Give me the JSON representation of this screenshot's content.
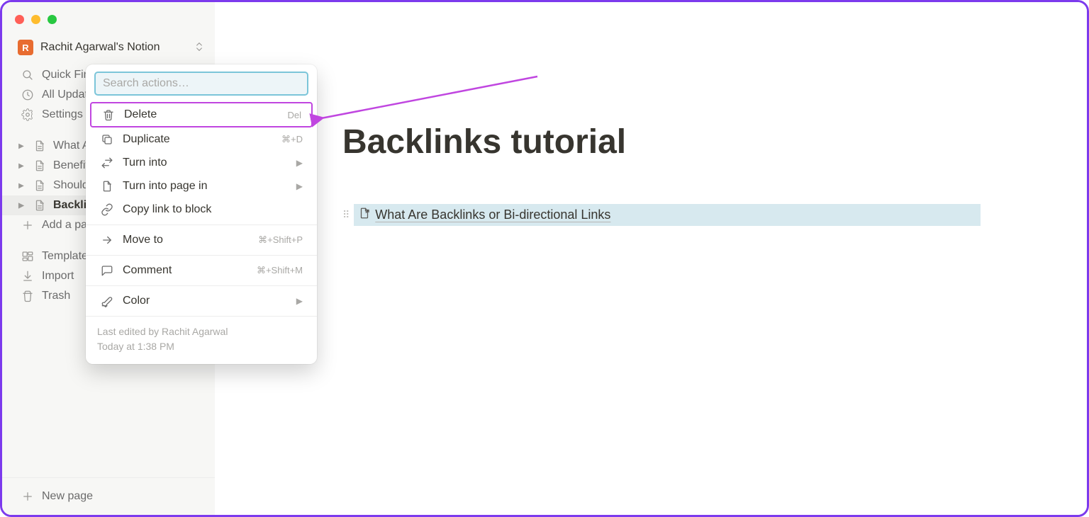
{
  "workspace": {
    "initial": "R",
    "name": "Rachit Agarwal's Notion"
  },
  "sidebar": {
    "quick_find": "Quick Find",
    "all_updates": "All Updates",
    "settings": "Settings",
    "pages": [
      {
        "label": "What Are Backlinks"
      },
      {
        "label": "Benefits"
      },
      {
        "label": "Should You Use"
      },
      {
        "label": "Backlinks tutorial"
      }
    ],
    "add_page": "Add a page",
    "templates": "Templates",
    "import": "Import",
    "trash": "Trash",
    "new_page": "New page"
  },
  "context_menu": {
    "search_placeholder": "Search actions…",
    "items": [
      {
        "label": "Delete",
        "kbd": "Del",
        "icon": "trash",
        "highlight": true
      },
      {
        "label": "Duplicate",
        "kbd": "⌘+D",
        "icon": "duplicate"
      },
      {
        "label": "Turn into",
        "kbd": "",
        "icon": "transform",
        "submenu": true
      },
      {
        "label": "Turn into page in",
        "kbd": "",
        "icon": "page",
        "submenu": true
      },
      {
        "label": "Copy link to block",
        "kbd": "",
        "icon": "link"
      }
    ],
    "items2": [
      {
        "label": "Move to",
        "kbd": "⌘+Shift+P",
        "icon": "arrow"
      }
    ],
    "items3": [
      {
        "label": "Comment",
        "kbd": "⌘+Shift+M",
        "icon": "comment"
      }
    ],
    "items4": [
      {
        "label": "Color",
        "kbd": "",
        "icon": "color",
        "submenu": true
      }
    ],
    "footer_line1": "Last edited by Rachit Agarwal",
    "footer_line2": "Today at 1:38 PM"
  },
  "page": {
    "title": "Backlinks tutorial",
    "linked_page": "What Are Backlinks or Bi-directional Links"
  },
  "annotation": {
    "color": "#c046e0"
  }
}
